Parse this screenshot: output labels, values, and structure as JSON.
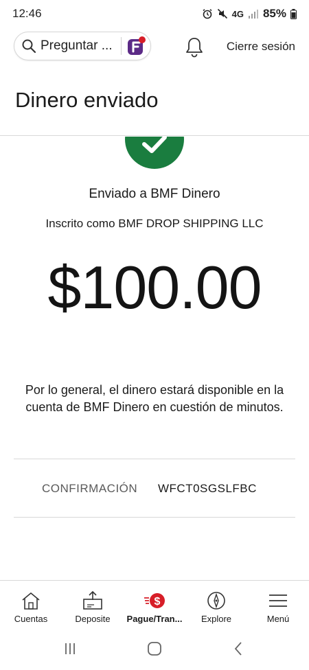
{
  "status_bar": {
    "time": "12:46",
    "network": "4G",
    "battery": "85%"
  },
  "header": {
    "search_label": "Preguntar ...",
    "signout_label": "Cierre sesión"
  },
  "page": {
    "title": "Dinero enviado"
  },
  "confirmation": {
    "sent_to": "Enviado a BMF Dinero",
    "enrolled_as": "Inscrito como BMF DROP SHIPPING LLC",
    "amount": "$100.00",
    "note": "Por lo general, el dinero estará disponible en la cuenta de BMF Dinero en cuestión de minutos.",
    "confirmation_label": "CONFIRMACIÓN",
    "confirmation_number": "WFCT0SGSLFBC"
  },
  "bottom_nav": {
    "items": [
      {
        "label": "Cuentas",
        "icon": "house-icon"
      },
      {
        "label": "Deposite",
        "icon": "deposit-icon"
      },
      {
        "label": "Pague/Tran...",
        "icon": "pay-transfer-icon",
        "active": true
      },
      {
        "label": "Explore",
        "icon": "compass-icon"
      },
      {
        "label": "Menú",
        "icon": "menu-icon"
      }
    ]
  },
  "colors": {
    "success_green": "#1a7d3f",
    "brand_red": "#d71e28",
    "assistant_purple": "#5b2a86"
  }
}
